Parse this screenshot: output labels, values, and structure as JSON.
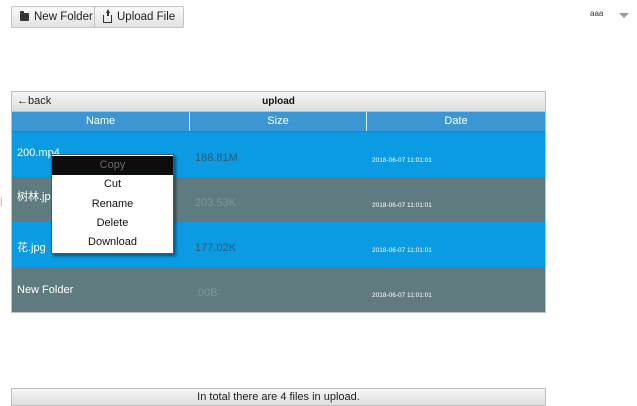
{
  "toolbar": {
    "new_folder_label": "New Folder",
    "upload_file_label": "Upload File"
  },
  "user": {
    "name": "aaa"
  },
  "panel": {
    "back_label": "←back",
    "current_folder": "upload",
    "columns": [
      "Name",
      "Size",
      "Date"
    ],
    "rows": [
      {
        "name": "200.mp4",
        "size": "188.81M",
        "date": "2018-06-07 11:01:01"
      },
      {
        "name": "树林.jpg",
        "size": "203.53K",
        "date": "2018-06-07 11:01:01"
      },
      {
        "name": "花.jpg",
        "size": "177.02K",
        "date": "2018-06-07 11:01:01"
      },
      {
        "name": "New Folder",
        "size": ".00B",
        "date": "2018-06-07 11:01:01"
      }
    ]
  },
  "context_menu": {
    "items": [
      "Copy",
      "Cut",
      "Rename",
      "Delete",
      "Download"
    ]
  },
  "footer": {
    "text": "In total there are 4 files in upload."
  },
  "colors": {
    "row_blue": "#0a9be2",
    "row_gray": "#607b7f",
    "header": "#3b97d3"
  }
}
